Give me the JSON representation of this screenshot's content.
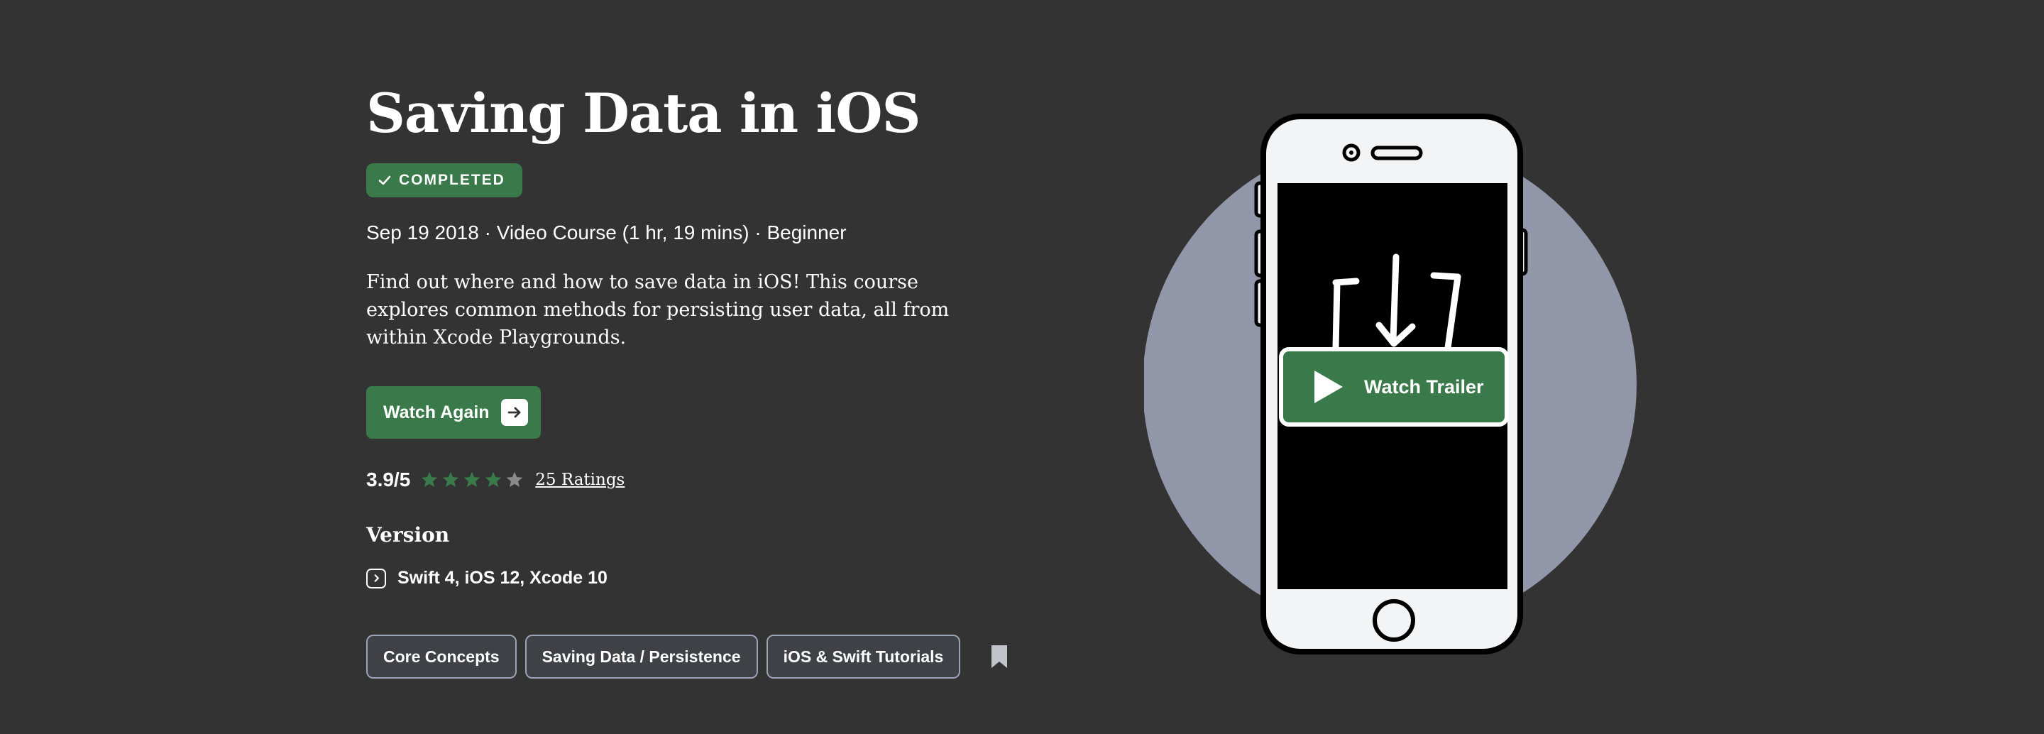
{
  "course": {
    "title": "Saving Data in iOS",
    "status_badge": "COMPLETED",
    "meta": "Sep 19 2018 · Video Course (1 hr, 19 mins) · Beginner",
    "description": "Find out where and how to save data in iOS! This course explores common methods for persisting user data, all from within Xcode Playgrounds.",
    "watch_button_label": "Watch Again",
    "rating": {
      "value_text": "3.9/5",
      "value": 3.9,
      "max": 5,
      "stars_filled": 4,
      "stars_total": 5,
      "ratings_link": "25 Ratings"
    },
    "version": {
      "heading": "Version",
      "text": "Swift 4, iOS 12, Xcode 10"
    },
    "tags": [
      "Core Concepts",
      "Saving Data / Persistence",
      "iOS & Swift Tutorials"
    ]
  },
  "trailer": {
    "label": "Watch Trailer"
  },
  "icons": {
    "badge": "checkmark-icon",
    "watch_button": "arrow-right-icon",
    "star": "star-icon",
    "version": "chevron-right-icon",
    "bookmark": "bookmark-icon",
    "trailer": "play-icon",
    "illustration_glyph": "download-tray-icon"
  },
  "colors": {
    "background": "#333333",
    "accent_green": "#3a7a4a",
    "star_filled": "#3a7a4a",
    "star_empty": "#8a8a8a",
    "tag_border": "#9aa3b5",
    "circle": "#9196a8",
    "bookmark": "#c2c4cc"
  }
}
